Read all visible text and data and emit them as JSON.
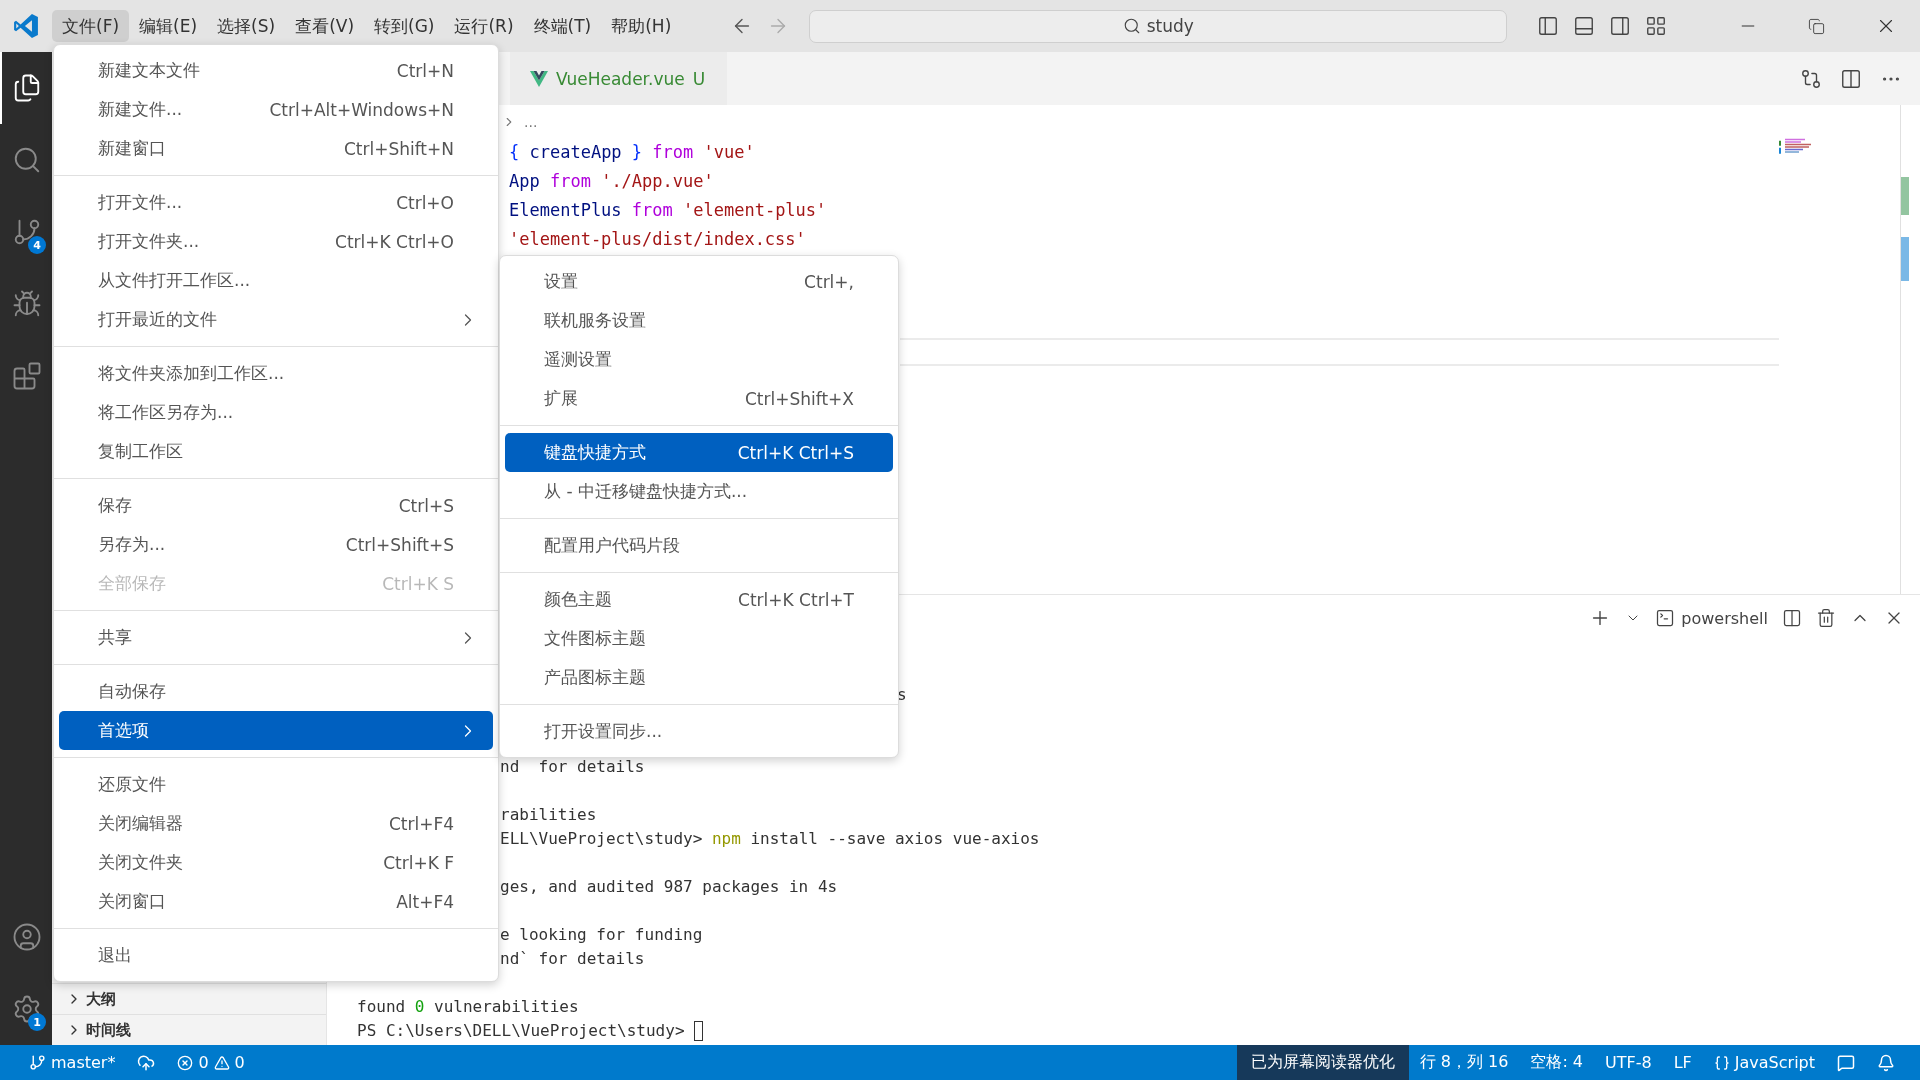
{
  "title_bar": {
    "menus": [
      {
        "label": "文件(F)",
        "selected": true
      },
      {
        "label": "编辑(E)",
        "selected": false
      },
      {
        "label": "选择(S)",
        "selected": false
      },
      {
        "label": "查看(V)",
        "selected": false
      },
      {
        "label": "转到(G)",
        "selected": false
      },
      {
        "label": "运行(R)",
        "selected": false
      },
      {
        "label": "终端(T)",
        "selected": false
      },
      {
        "label": "帮助(H)",
        "selected": false
      }
    ],
    "search": {
      "value": "study"
    }
  },
  "activity_bar": {
    "items": [
      {
        "selected": true
      },
      {
        "selected": false
      },
      {
        "selected": false,
        "badge": "4"
      },
      {
        "selected": false
      },
      {
        "selected": false
      }
    ],
    "bottom": [
      {
        "selected": false
      },
      {
        "selected": false,
        "badge": "1"
      }
    ]
  },
  "sidebar": {
    "sections": [
      {
        "label": "大纲",
        "expanded": false
      },
      {
        "label": "时间线",
        "expanded": false
      }
    ]
  },
  "editor": {
    "tabs": [
      {
        "label": "VueHeader.vue",
        "status": "U",
        "selected": false
      }
    ],
    "breadcrumb": "...",
    "lines": [
      [
        {
          "text": "{ ",
          "kind": "punct"
        },
        {
          "text": "createApp",
          "kind": "variable"
        },
        {
          "text": " } ",
          "kind": "punct"
        },
        {
          "text": "from ",
          "kind": "keyword"
        },
        {
          "text": "'vue'",
          "kind": "string"
        }
      ],
      [
        {
          "text": "App ",
          "kind": "variable"
        },
        {
          "text": "from ",
          "kind": "keyword"
        },
        {
          "text": "'./App.vue'",
          "kind": "string"
        }
      ],
      [
        {
          "text": "ElementPlus ",
          "kind": "variable"
        },
        {
          "text": "from ",
          "kind": "keyword"
        },
        {
          "text": "'element-plus'",
          "kind": "string"
        }
      ],
      [
        {
          "text": "'element-plus/dist/index.css'",
          "kind": "string"
        }
      ]
    ]
  },
  "panel": {
    "shell": "powershell",
    "lines": [
      {
        "kind": "past-submenu",
        "tokens": [
          {
            "text": "s",
            "kind": "plain"
          }
        ]
      },
      {
        "kind": "blank"
      },
      {
        "kind": "blank"
      },
      {
        "kind": "past-menu",
        "tokens": [
          {
            "text": "nd  for details",
            "kind": "plain"
          }
        ]
      },
      {
        "kind": "blank"
      },
      {
        "kind": "past-menu",
        "tokens": [
          {
            "text": "rabilities",
            "kind": "plain"
          }
        ]
      },
      {
        "kind": "past-menu",
        "tokens": [
          {
            "text": "ELL\\VueProject\\study> ",
            "kind": "plain"
          },
          {
            "text": "npm",
            "kind": "command"
          },
          {
            "text": " install --save axios vue-axios",
            "kind": "plain"
          }
        ]
      },
      {
        "kind": "blank"
      },
      {
        "kind": "past-menu",
        "tokens": [
          {
            "text": "ges, and audited 987 packages in 4s",
            "kind": "plain"
          }
        ]
      },
      {
        "kind": "blank"
      },
      {
        "kind": "past-menu",
        "tokens": [
          {
            "text": "e looking for funding",
            "kind": "plain"
          }
        ]
      },
      {
        "kind": "past-menu",
        "tokens": [
          {
            "text": "nd` for details",
            "kind": "plain"
          }
        ]
      },
      {
        "kind": "blank"
      },
      {
        "kind": "full",
        "tokens": [
          {
            "text": "found ",
            "kind": "plain"
          },
          {
            "text": "0",
            "kind": "number"
          },
          {
            "text": " vulnerabilities",
            "kind": "plain"
          }
        ]
      },
      {
        "kind": "prompt",
        "tokens": [
          {
            "text": "PS C:\\Users\\DELL\\VueProject\\study> ",
            "kind": "plain"
          }
        ]
      }
    ]
  },
  "file_menu": {
    "groups": [
      [
        {
          "label": "新建文本文件",
          "shortcut": "Ctrl+N",
          "kind": "action",
          "disabled": false,
          "selected": false
        },
        {
          "label": "新建文件...",
          "shortcut": "Ctrl+Alt+Windows+N",
          "kind": "action",
          "disabled": false,
          "selected": false
        },
        {
          "label": "新建窗口",
          "shortcut": "Ctrl+Shift+N",
          "kind": "action",
          "disabled": false,
          "selected": false
        }
      ],
      [
        {
          "label": "打开文件...",
          "shortcut": "Ctrl+O",
          "kind": "action",
          "disabled": false,
          "selected": false
        },
        {
          "label": "打开文件夹...",
          "shortcut": "Ctrl+K Ctrl+O",
          "kind": "action",
          "disabled": false,
          "selected": false
        },
        {
          "label": "从文件打开工作区...",
          "kind": "action",
          "disabled": false,
          "selected": false
        },
        {
          "label": "打开最近的文件",
          "kind": "submenu",
          "disabled": false,
          "selected": false
        }
      ],
      [
        {
          "label": "将文件夹添加到工作区...",
          "kind": "action",
          "disabled": false,
          "selected": false
        },
        {
          "label": "将工作区另存为...",
          "kind": "action",
          "disabled": false,
          "selected": false
        },
        {
          "label": "复制工作区",
          "kind": "action",
          "disabled": false,
          "selected": false
        }
      ],
      [
        {
          "label": "保存",
          "shortcut": "Ctrl+S",
          "kind": "action",
          "disabled": false,
          "selected": false
        },
        {
          "label": "另存为...",
          "shortcut": "Ctrl+Shift+S",
          "kind": "action",
          "disabled": false,
          "selected": false
        },
        {
          "label": "全部保存",
          "shortcut": "Ctrl+K S",
          "kind": "action",
          "disabled": true,
          "selected": false
        }
      ],
      [
        {
          "label": "共享",
          "kind": "submenu",
          "disabled": false,
          "selected": false
        }
      ],
      [
        {
          "label": "自动保存",
          "kind": "action",
          "disabled": false,
          "selected": false
        },
        {
          "label": "首选项",
          "kind": "submenu",
          "disabled": false,
          "selected": true
        }
      ],
      [
        {
          "label": "还原文件",
          "kind": "action",
          "disabled": false,
          "selected": false
        },
        {
          "label": "关闭编辑器",
          "shortcut": "Ctrl+F4",
          "kind": "action",
          "disabled": false,
          "selected": false
        },
        {
          "label": "关闭文件夹",
          "shortcut": "Ctrl+K F",
          "kind": "action",
          "disabled": false,
          "selected": false
        },
        {
          "label": "关闭窗口",
          "shortcut": "Alt+F4",
          "kind": "action",
          "disabled": false,
          "selected": false
        }
      ],
      [
        {
          "label": "退出",
          "kind": "action",
          "disabled": false,
          "selected": false
        }
      ]
    ]
  },
  "preferences_submenu": {
    "groups": [
      [
        {
          "label": "设置",
          "shortcut": "Ctrl+,",
          "kind": "action",
          "disabled": false,
          "selected": false
        },
        {
          "label": "联机服务设置",
          "kind": "action",
          "disabled": false,
          "selected": false
        },
        {
          "label": "遥测设置",
          "kind": "action",
          "disabled": false,
          "selected": false
        },
        {
          "label": "扩展",
          "shortcut": "Ctrl+Shift+X",
          "kind": "action",
          "disabled": false,
          "selected": false
        }
      ],
      [
        {
          "label": "键盘快捷方式",
          "shortcut": "Ctrl+K Ctrl+S",
          "kind": "action",
          "disabled": false,
          "selected": true
        },
        {
          "label": "从 - 中迁移键盘快捷方式...",
          "kind": "action",
          "disabled": false,
          "selected": false
        }
      ],
      [
        {
          "label": "配置用户代码片段",
          "kind": "action",
          "disabled": false,
          "selected": false
        }
      ],
      [
        {
          "label": "颜色主题",
          "shortcut": "Ctrl+K Ctrl+T",
          "kind": "action",
          "disabled": false,
          "selected": false
        },
        {
          "label": "文件图标主题",
          "kind": "action",
          "disabled": false,
          "selected": false
        },
        {
          "label": "产品图标主题",
          "kind": "action",
          "disabled": false,
          "selected": false
        }
      ],
      [
        {
          "label": "打开设置同步...",
          "kind": "action",
          "disabled": false,
          "selected": false
        }
      ]
    ]
  },
  "status_bar": {
    "left": [
      {
        "kind": "branch",
        "text": "master*"
      },
      {
        "kind": "sync"
      },
      {
        "kind": "problems",
        "errors": "0",
        "warnings": "0"
      }
    ],
    "right": [
      {
        "kind": "highlight",
        "text": "已为屏幕阅读器优化"
      },
      {
        "kind": "text",
        "text": "行 8，列 16"
      },
      {
        "kind": "text",
        "text": "空格: 4"
      },
      {
        "kind": "text",
        "text": "UTF-8"
      },
      {
        "kind": "text",
        "text": "LF"
      },
      {
        "kind": "language",
        "text": "JavaScript"
      },
      {
        "kind": "feedback"
      },
      {
        "kind": "bell"
      }
    ]
  }
}
